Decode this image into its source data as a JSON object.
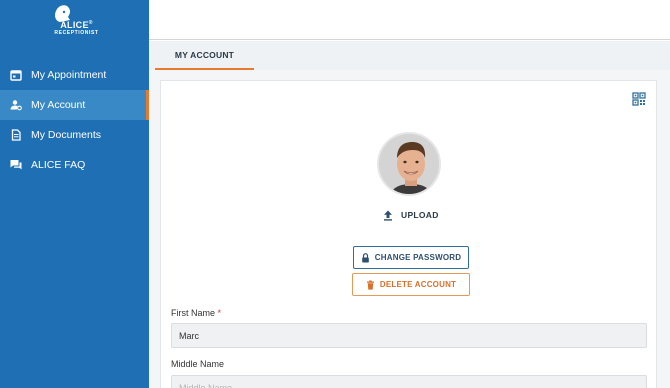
{
  "brand": {
    "name": "ALICE",
    "tm": "®",
    "subtitle": "RECEPTIONIST"
  },
  "sidebar": {
    "items": [
      {
        "label": "My Appointment",
        "icon": "calendar-icon",
        "active": false
      },
      {
        "label": "My Account",
        "icon": "user-settings-icon",
        "active": true
      },
      {
        "label": "My Documents",
        "icon": "document-icon",
        "active": false
      },
      {
        "label": "ALICE FAQ",
        "icon": "chat-icon",
        "active": false
      }
    ]
  },
  "tabs": [
    {
      "label": "MY ACCOUNT",
      "active": true
    }
  ],
  "profile": {
    "upload_label": "UPLOAD",
    "change_password_label": "CHANGE PASSWORD",
    "delete_account_label": "DELETE ACCOUNT"
  },
  "form": {
    "first_name": {
      "label": "First Name",
      "required_mark": "*",
      "value": "Marc"
    },
    "middle_name": {
      "label": "Middle Name",
      "placeholder": "Middle Name",
      "value": ""
    }
  },
  "colors": {
    "sidebar_bg": "#1f6fb4",
    "sidebar_active": "#3a89c7",
    "accent_orange": "#e77a2c",
    "primary_dark": "#2f4f6f"
  }
}
